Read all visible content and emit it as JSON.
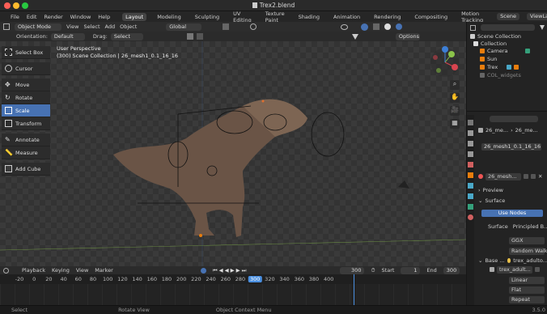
{
  "window": {
    "title": "Trex2.blend"
  },
  "menu": {
    "items": [
      "File",
      "Edit",
      "Render",
      "Window",
      "Help"
    ],
    "workspaces": [
      "Layout",
      "Modeling",
      "Sculpting",
      "UV Editing",
      "Texture Paint",
      "Shading",
      "Animation",
      "Rendering",
      "Compositing",
      "Motion Tracking"
    ],
    "active_workspace": "Layout",
    "scene": "Scene",
    "view_layer": "ViewLayer"
  },
  "header": {
    "mode": "Object Mode",
    "menus": [
      "View",
      "Select",
      "Add",
      "Object"
    ],
    "transform": "Global",
    "orientation_label": "Orientation:",
    "orientation": "Default",
    "drag_label": "Drag:",
    "drag": "Select Box",
    "options": "Options"
  },
  "tools": [
    {
      "label": "Select Box",
      "icon": "select-box-icon"
    },
    {
      "label": "Cursor",
      "icon": "cursor-icon"
    },
    {
      "label": "Move",
      "icon": "move-icon"
    },
    {
      "label": "Rotate",
      "icon": "rotate-icon"
    },
    {
      "label": "Scale",
      "icon": "scale-icon",
      "active": true
    },
    {
      "label": "Transform",
      "icon": "transform-icon"
    },
    {
      "label": "Annotate",
      "icon": "annotate-icon"
    },
    {
      "label": "Measure",
      "icon": "measure-icon"
    },
    {
      "label": "Add Cube",
      "icon": "add-cube-icon"
    }
  ],
  "viewport": {
    "line1": "User Perspective",
    "line2": "(300) Scene Collection | 26_mesh1_0.1_16_16"
  },
  "outliner": {
    "root": "Scene Collection",
    "collection": "Collection",
    "items": [
      "Camera",
      "Sun",
      "Trex"
    ],
    "col_widgets": "COL_widgets"
  },
  "properties": {
    "breadcrumb_a": "26_me...",
    "breadcrumb_b": "26_me...",
    "object_name": "26_mesh1_0.1_16_16",
    "material_slot": "26_mesh...",
    "preview": "Preview",
    "surface_section": "Surface",
    "use_nodes": "Use Nodes",
    "surface_label": "Surface",
    "surface_value": "Principled B...",
    "distribution": "GGX",
    "subsurface": "Random Walk",
    "base_label": "Base ...",
    "base_value": "trex_adulto...",
    "texture": "trex_adult...",
    "interp": "Linear",
    "projection": "Flat",
    "extension": "Repeat"
  },
  "timeline": {
    "menus": [
      "Playback",
      "Keying",
      "View",
      "Marker"
    ],
    "current_frame": "300",
    "start_label": "Start",
    "start": "1",
    "end_label": "End",
    "end": "300",
    "ticks": [
      "-20",
      "0",
      "20",
      "40",
      "60",
      "80",
      "100",
      "120",
      "140",
      "160",
      "180",
      "200",
      "220",
      "240",
      "260",
      "280",
      "300",
      "320",
      "340",
      "360",
      "380",
      "400"
    ]
  },
  "status": {
    "select": "Select",
    "rotate": "Rotate View",
    "context": "Object Context Menu",
    "version": "3.5.0"
  },
  "colors": {
    "accent": "#4772b3",
    "axis_x": "#d8444f",
    "axis_y": "#8bc34a",
    "axis_z": "#3d7fd6",
    "playhead": "#4a8fe0"
  }
}
